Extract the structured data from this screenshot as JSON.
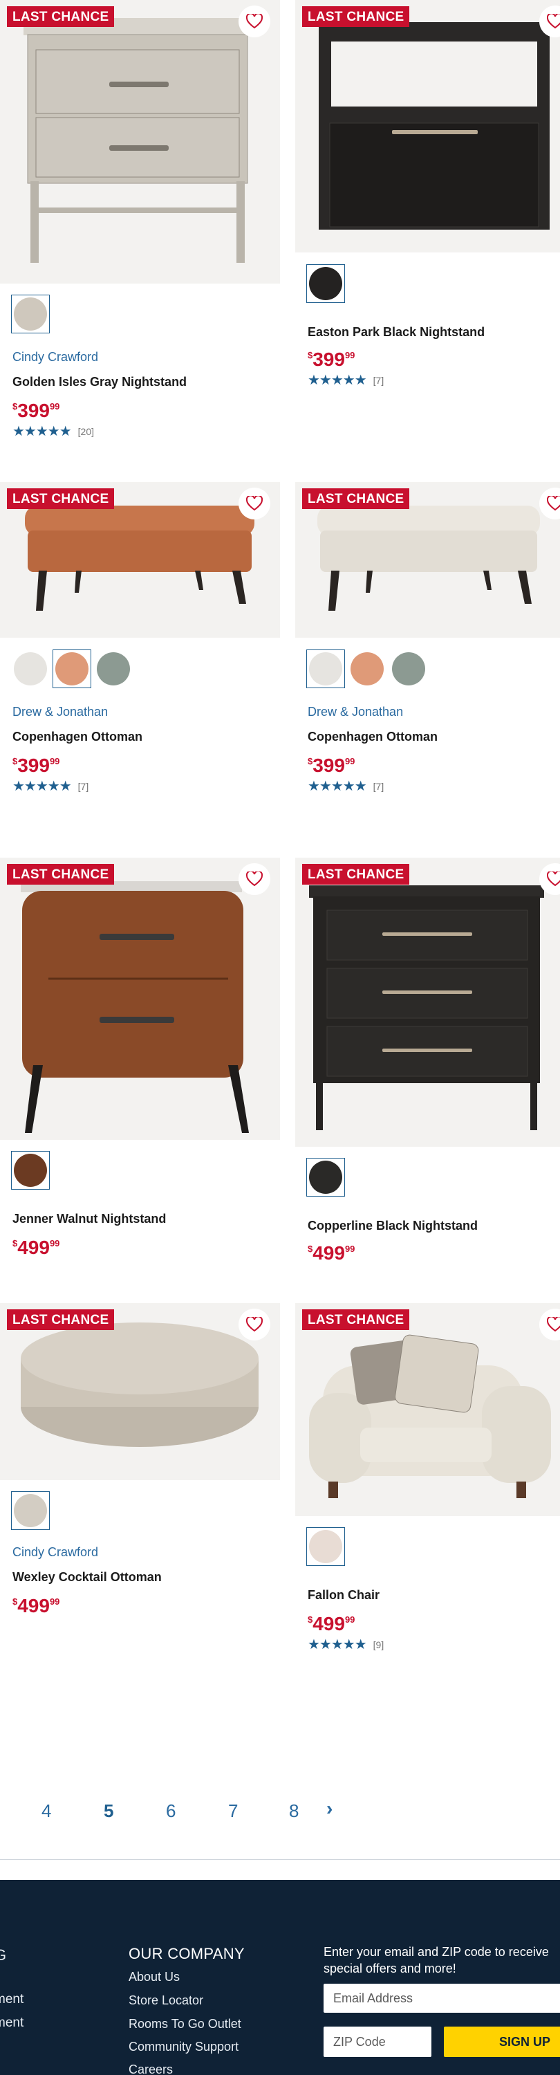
{
  "badge_text": "LAST CHANCE",
  "products": [
    {
      "brand": "Cindy Crawford",
      "name": "Golden Isles Gray Nightstand",
      "price_main": "399",
      "price_cents": "99",
      "rating_count": "[20]",
      "swatches": [
        "#cfc8bd"
      ]
    },
    {
      "brand": "",
      "name": "Easton Park Black Nightstand",
      "price_main": "399",
      "price_cents": "99",
      "rating_count": "[7]",
      "swatches": [
        "#242221"
      ]
    },
    {
      "brand": "Drew & Jonathan",
      "name": "Copenhagen Ottoman",
      "price_main": "399",
      "price_cents": "99",
      "rating_count": "[7]",
      "swatches": [
        "#e6e4e0",
        "#df9a78",
        "#8c9a92"
      ]
    },
    {
      "brand": "Drew & Jonathan",
      "name": "Copenhagen Ottoman",
      "price_main": "399",
      "price_cents": "99",
      "rating_count": "[7]",
      "swatches": [
        "#e6e4e0",
        "#df9a78",
        "#8c9a92"
      ]
    },
    {
      "brand": "",
      "name": "Jenner Walnut Nightstand",
      "price_main": "499",
      "price_cents": "99",
      "rating_count": "",
      "swatches": [
        "#6b3a22"
      ]
    },
    {
      "brand": "",
      "name": "Copperline Black Nightstand",
      "price_main": "499",
      "price_cents": "99",
      "rating_count": "",
      "swatches": [
        "#2a2927"
      ]
    },
    {
      "brand": "Cindy Crawford",
      "name": "Wexley Cocktail Ottoman",
      "price_main": "499",
      "price_cents": "99",
      "rating_count": "",
      "swatches": [
        "#d3cdc3"
      ]
    },
    {
      "brand": "",
      "name": "Fallon Chair",
      "price_main": "499",
      "price_cents": "99",
      "rating_count": "[9]",
      "swatches": [
        "#e8dcd4"
      ]
    }
  ],
  "pagination": {
    "pages": [
      "4",
      "5",
      "6",
      "7",
      "8"
    ],
    "current": "5",
    "next_icon": "›"
  },
  "footer": {
    "partial_heading": "G",
    "partial_links": [
      "ment",
      "ment"
    ],
    "company_heading": "OUR COMPANY",
    "company_links": [
      "About Us",
      "Store Locator",
      "Rooms To Go Outlet",
      "Community Support",
      "Careers"
    ],
    "newsletter_text": "Enter your email and ZIP code to receive special offers and more!",
    "email_placeholder": "Email Address",
    "zip_placeholder": "ZIP Code",
    "signup_label": "SIGN UP"
  },
  "colors": {
    "accent_red": "#c8102e",
    "link_blue": "#2a6aa0",
    "footer_bg": "#0f2236",
    "signup_yellow": "#ffd200"
  }
}
